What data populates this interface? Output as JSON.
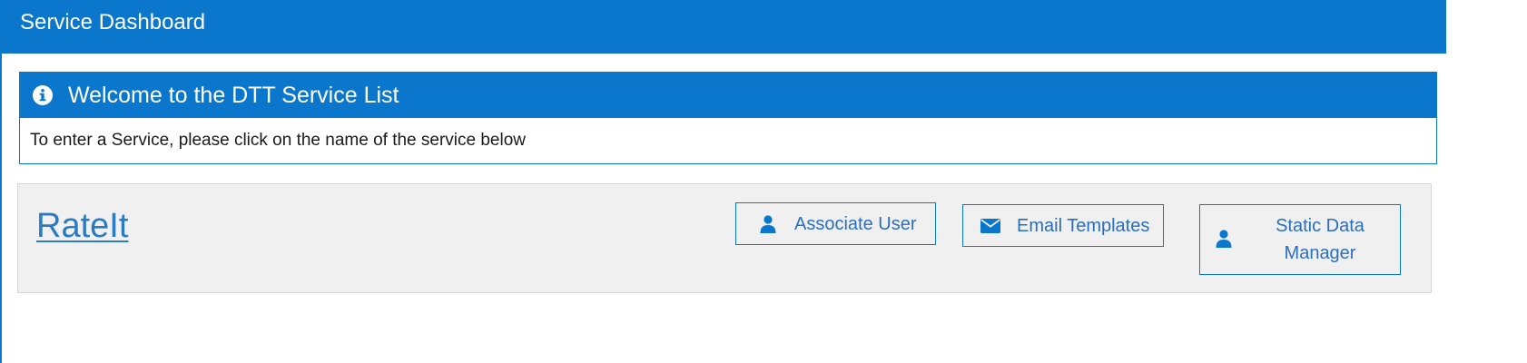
{
  "header": {
    "title": "Service Dashboard"
  },
  "welcome_panel": {
    "icon": "info-circle-icon",
    "title": "Welcome to the DTT Service List",
    "body": "To enter a Service, please click on the name of the service below"
  },
  "services": [
    {
      "name": "RateIt",
      "actions": {
        "associate_user": {
          "label": "Associate User",
          "icon": "user-icon"
        },
        "email_templates": {
          "label": "Email Templates",
          "icon": "envelope-icon"
        },
        "static_data_manager": {
          "label": "Static Data Manager",
          "icon": "user-icon"
        }
      }
    }
  ],
  "colors": {
    "brand_blue": "#0b77cc",
    "link_blue": "#2a7bc4",
    "row_background": "#f0f0f0"
  }
}
